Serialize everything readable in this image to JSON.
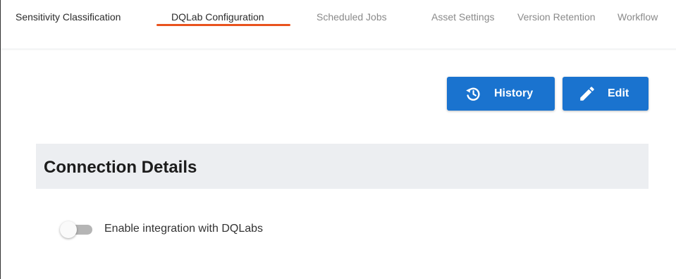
{
  "tabs": [
    {
      "label": "Sensitivity Classification"
    },
    {
      "label": "DQLab Configuration",
      "active": true
    },
    {
      "label": "Scheduled Jobs"
    },
    {
      "label": "Asset Settings"
    },
    {
      "label": "Version Retention"
    },
    {
      "label": "Workflow"
    }
  ],
  "toolbar": {
    "history_label": "History",
    "history_icon": "history-icon",
    "edit_label": "Edit",
    "edit_icon": "pencil-icon"
  },
  "section": {
    "title": "Connection Details"
  },
  "integration": {
    "toggle_label": "Enable integration with DQLabs",
    "enabled": false
  },
  "colors": {
    "accent": "#1a73cf",
    "tab_indicator": "#e9531e",
    "section_bg": "#eceef1"
  }
}
